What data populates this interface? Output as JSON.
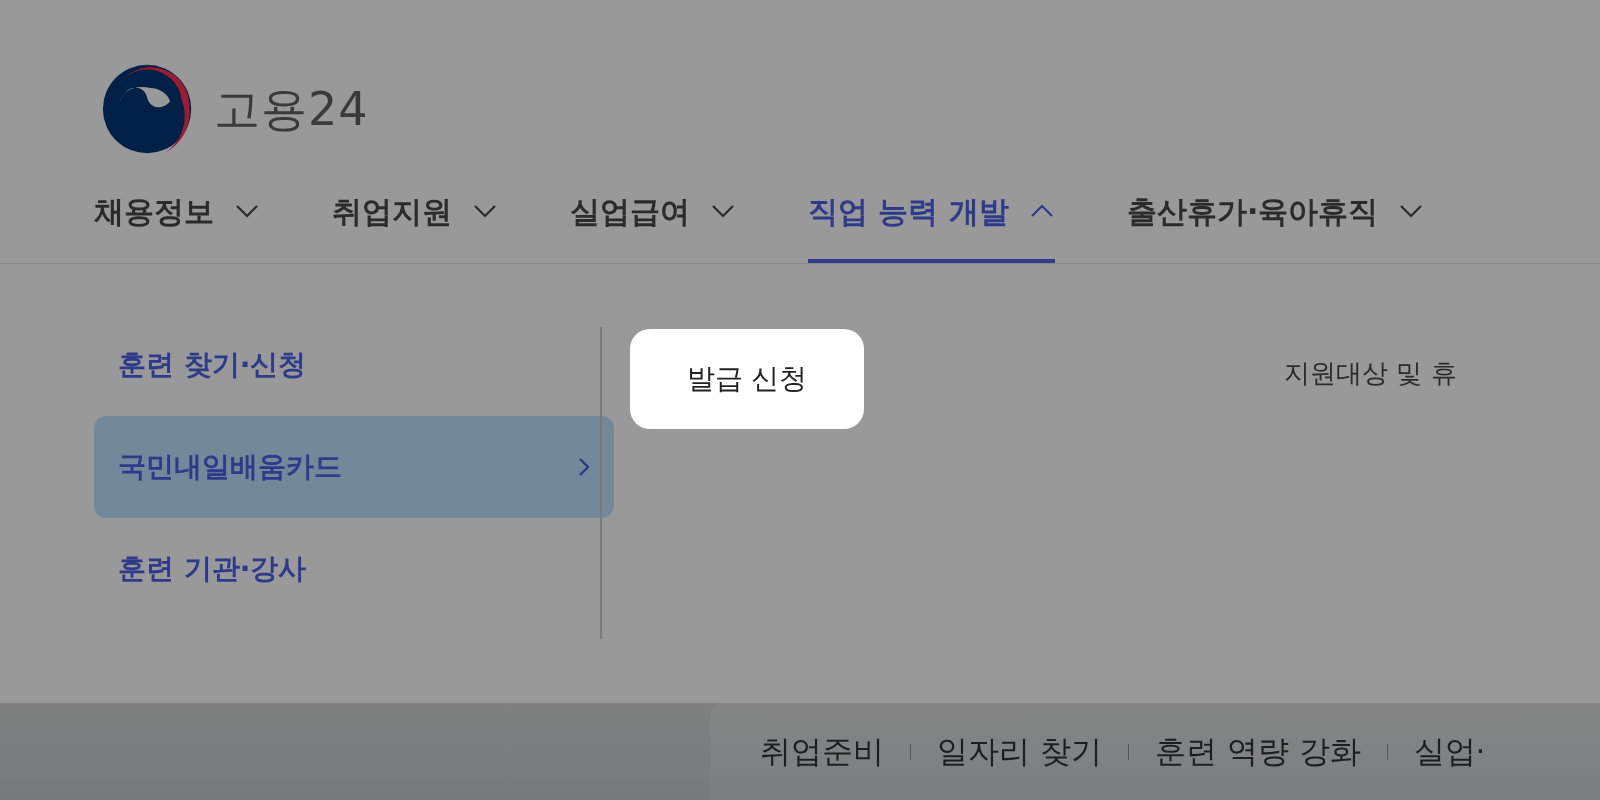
{
  "header": {
    "logo_text": "고용24"
  },
  "nav": [
    {
      "label": "채용정보",
      "selected": false,
      "expanded": false
    },
    {
      "label": "취업지원",
      "selected": false,
      "expanded": false
    },
    {
      "label": "실업급여",
      "selected": false,
      "expanded": false
    },
    {
      "label": "직업 능력 개발",
      "selected": true,
      "expanded": true
    },
    {
      "label": "출산휴가·육아휴직",
      "selected": false,
      "expanded": false
    }
  ],
  "submenu": [
    {
      "label": "훈련 찾기·신청",
      "selected": false
    },
    {
      "label": "국민내일배움카드",
      "selected": true
    },
    {
      "label": "훈련 기관·강사",
      "selected": false
    }
  ],
  "panel": {
    "button": "발급 신청",
    "text": "지원대상 및 휴"
  },
  "footer_links": [
    "취업준비",
    "일자리 찾기",
    "훈련 역량 강화",
    "실업·"
  ]
}
